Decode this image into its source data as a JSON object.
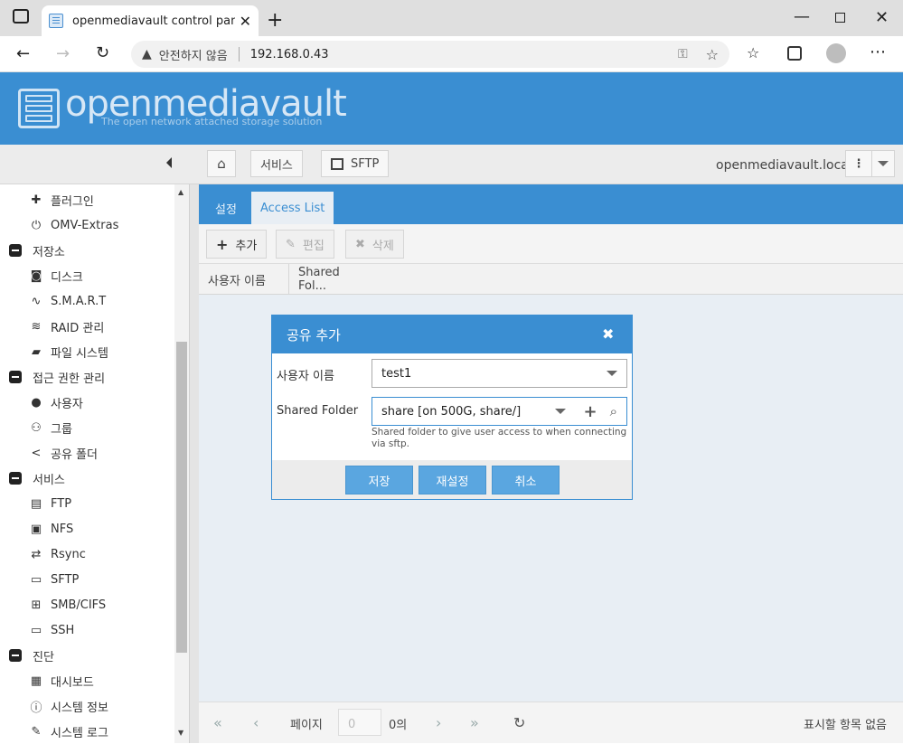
{
  "browser": {
    "tab_title": "openmediavault control panel - c",
    "security_label": "안전하지 않음",
    "url": "192.168.0.43"
  },
  "omv": {
    "logo_title": "openmediavault",
    "logo_subtitle": "The open network attached storage solution"
  },
  "breadcrumb": {
    "item1": "서비스",
    "item2": "SFTP",
    "hostname": "openmediavault.local"
  },
  "sidebar": {
    "items": [
      {
        "label": "플러그인",
        "icon": "puzzle-icon",
        "group": false
      },
      {
        "label": "OMV-Extras",
        "icon": "plug-icon",
        "group": false
      },
      {
        "label": "저장소",
        "icon": "collapse-icon",
        "group": true
      },
      {
        "label": "디스크",
        "icon": "disk-icon",
        "group": false
      },
      {
        "label": "S.M.A.R.T",
        "icon": "pulse-icon",
        "group": false
      },
      {
        "label": "RAID 관리",
        "icon": "database-icon",
        "group": false
      },
      {
        "label": "파일 시스템",
        "icon": "folder-icon",
        "group": false
      },
      {
        "label": "접근 권한 관리",
        "icon": "collapse-icon",
        "group": true
      },
      {
        "label": "사용자",
        "icon": "user-icon",
        "group": false
      },
      {
        "label": "그룹",
        "icon": "users-icon",
        "group": false
      },
      {
        "label": "공유 폴더",
        "icon": "share-icon",
        "group": false
      },
      {
        "label": "서비스",
        "icon": "collapse-icon",
        "group": true
      },
      {
        "label": "FTP",
        "icon": "server-icon",
        "group": false
      },
      {
        "label": "NFS",
        "icon": "network-icon",
        "group": false
      },
      {
        "label": "Rsync",
        "icon": "sync-icon",
        "group": false
      },
      {
        "label": "SFTP",
        "icon": "terminal-icon",
        "group": false
      },
      {
        "label": "SMB/CIFS",
        "icon": "windows-icon",
        "group": false
      },
      {
        "label": "SSH",
        "icon": "terminal-icon",
        "group": false
      },
      {
        "label": "진단",
        "icon": "collapse-icon",
        "group": true
      },
      {
        "label": "대시보드",
        "icon": "dashboard-icon",
        "group": false
      },
      {
        "label": "시스템 정보",
        "icon": "info-icon",
        "group": false
      },
      {
        "label": "시스템 로그",
        "icon": "edit-icon",
        "group": false
      }
    ]
  },
  "panel": {
    "tabs": [
      "설정",
      "Access List"
    ],
    "actions": {
      "add": "추가",
      "edit": "편집",
      "delete": "삭제"
    },
    "columns": [
      "사용자 이름",
      "Shared Fol..."
    ],
    "pager": {
      "page_label": "페이지",
      "page_value": "0",
      "of_label": "0의",
      "empty_text": "표시할 항목 없음"
    }
  },
  "dialog": {
    "title": "공유 추가",
    "user_label": "사용자 이름",
    "user_value": "test1",
    "folder_label": "Shared Folder",
    "folder_value": "share [on 500G, share/]",
    "folder_hint": "Shared folder to give user access to when connecting via sftp.",
    "buttons": {
      "save": "저장",
      "reset": "재설정",
      "cancel": "취소"
    }
  },
  "colors": {
    "accent": "#3a8ed2",
    "button": "#5aa6e0"
  }
}
